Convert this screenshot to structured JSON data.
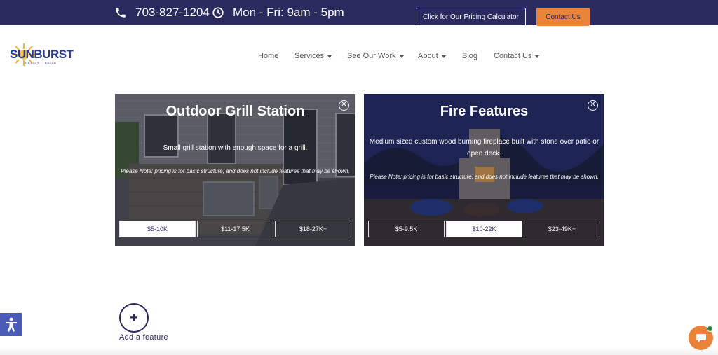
{
  "topbar": {
    "phone": "703-827-1204",
    "hours": "Mon - Fri: 9am - 5pm",
    "pricing_button": "Click for Our Pricing Calculator",
    "contact_button": "Contact Us",
    "phone_icon": "phone-icon",
    "clock_icon": "clock-icon",
    "bar_color": "#2a2a5e",
    "accent_color": "#e9833a"
  },
  "logo": {
    "word": "SUNBURST",
    "sub": "DESIGN · BUILD"
  },
  "nav": {
    "items": [
      {
        "label": "Home",
        "dropdown": false
      },
      {
        "label": "Services",
        "dropdown": true
      },
      {
        "label": "See Our Work",
        "dropdown": true
      },
      {
        "label": "About",
        "dropdown": true
      },
      {
        "label": "Blog",
        "dropdown": false
      },
      {
        "label": "Contact Us",
        "dropdown": true
      }
    ]
  },
  "cards": [
    {
      "title": "Outdoor Grill Station",
      "description": "Small grill station with enough space for a grill.",
      "note": "Please Note: pricing is for basic structure, and does not include features that may be shown.",
      "prices": [
        "$5-10K",
        "$11-17.5K",
        "$18-27K+"
      ],
      "selected": "$5-10K"
    },
    {
      "title": "Fire Features",
      "description": "Medium sized custom wood burning fireplace built with stone over patio or open deck.",
      "note": "Please Note: pricing is for basic structure, and does not include features that may be shown.",
      "prices": [
        "$5-9.5K",
        "$10-22K",
        "$23-49K+"
      ],
      "selected": "$10-22K"
    }
  ],
  "add_feature": {
    "label": "Add a feature",
    "icon": "plus-icon"
  },
  "widgets": {
    "accessibility_icon": "accessibility-icon",
    "chat_icon": "chat-icon"
  }
}
